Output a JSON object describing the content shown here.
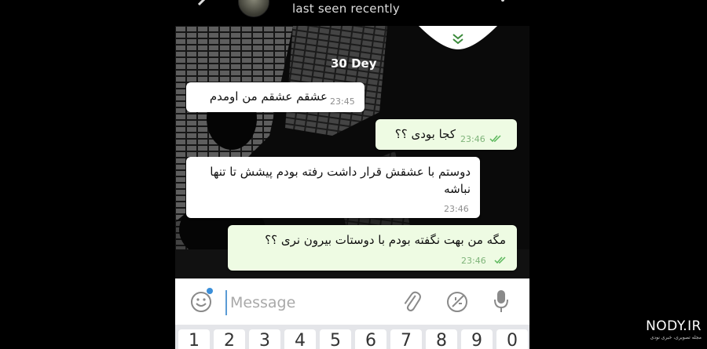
{
  "header": {
    "status": "last seen recently"
  },
  "chat": {
    "date_label": "30 Dey",
    "messages": [
      {
        "direction": "in",
        "text": "عشقم عشقم من اومدم",
        "time": "23:45"
      },
      {
        "direction": "out",
        "text": "کجا بودی ؟؟",
        "time": "23:46"
      },
      {
        "direction": "in",
        "text": "دوستم با عشقش قرار داشت رفته بودم پیشش تا تنها نباشه",
        "time": "23:46"
      },
      {
        "direction": "out",
        "text": "مگه من بهت نگفته بودم با دوستات بیرون نری ؟؟",
        "time": "23:46"
      }
    ]
  },
  "input": {
    "placeholder": "Message"
  },
  "keyboard": {
    "keys": [
      "1",
      "2",
      "3",
      "4",
      "5",
      "6",
      "7",
      "8",
      "9",
      "0"
    ]
  },
  "watermark": {
    "title": "NODY.IR",
    "subtitle": "مجله تصویری، خبری نودی"
  },
  "colors": {
    "incoming_bubble": "#ffffff",
    "outgoing_bubble": "#eefbe3",
    "read_ticks": "#5cb85c",
    "accent": "#3b8fd9"
  }
}
